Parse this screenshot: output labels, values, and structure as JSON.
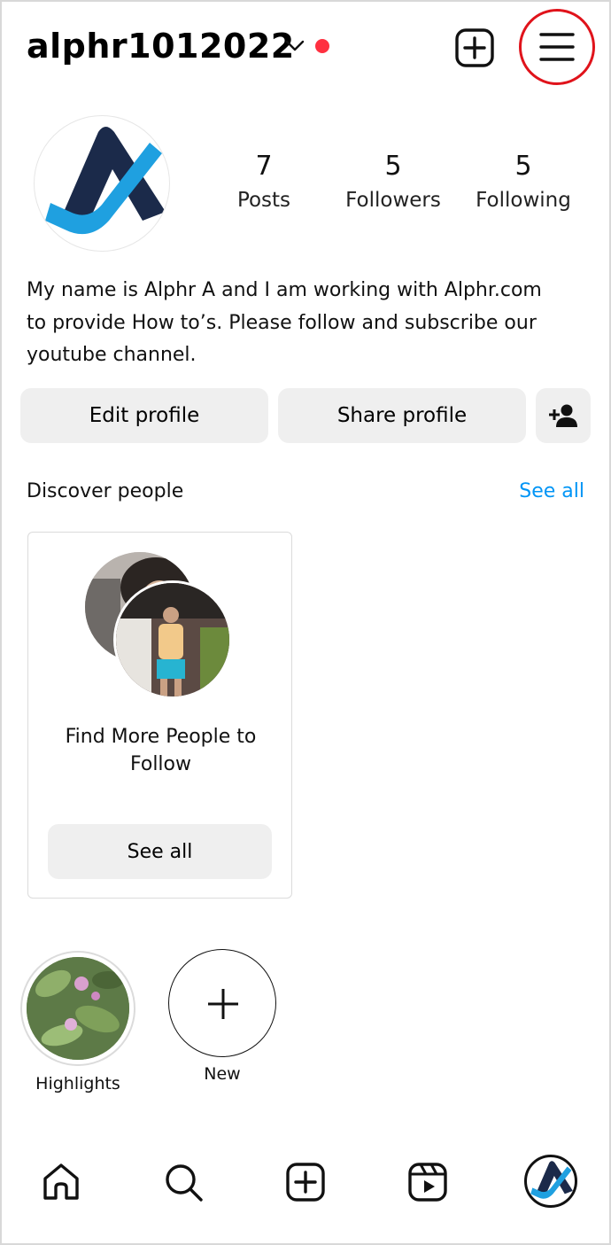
{
  "header": {
    "username": "alphr1012022",
    "icons": [
      "chevron-down-icon",
      "create-post-icon",
      "menu-icon"
    ],
    "notification_dot_color": "#ff3040",
    "highlight_ring_color": "#e0131b"
  },
  "profile": {
    "stats": [
      {
        "value": "7",
        "label": "Posts"
      },
      {
        "value": "5",
        "label": "Followers"
      },
      {
        "value": "5",
        "label": "Following"
      }
    ],
    "bio_lines": [
      "My name is Alphr A and I am working with Alphr.com",
      "to provide How to’s. Please follow and subscribe our",
      "youtube channel."
    ]
  },
  "actions": {
    "edit_profile": "Edit profile",
    "share_profile": "Share profile",
    "add_person_icon": "add-person-icon"
  },
  "discover": {
    "title": "Discover people",
    "see_all": "See all",
    "card_title": "Find More People to Follow",
    "card_button": "See all"
  },
  "highlights": [
    {
      "label": "Highlights"
    },
    {
      "label": "New"
    }
  ],
  "bottom_nav": [
    "home-icon",
    "search-icon",
    "create-icon",
    "reels-icon",
    "profile-avatar"
  ],
  "colors": {
    "accent": "#0095f6",
    "button_bg": "#efefef",
    "brand_dark": "#1b2a4a",
    "brand_blue": "#1fa0e0"
  }
}
